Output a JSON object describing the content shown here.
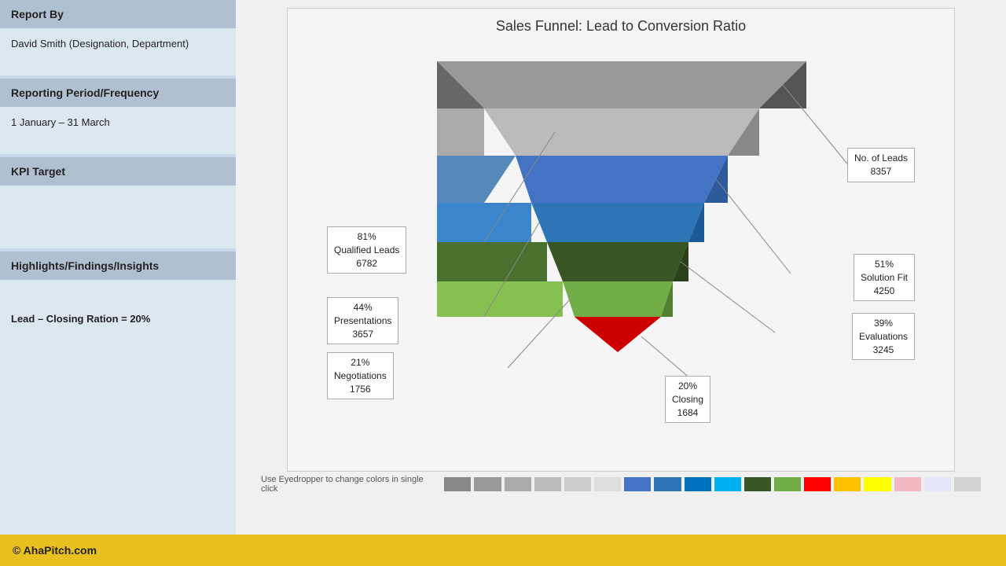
{
  "sidebar": {
    "report_by_label": "Report By",
    "report_by_value": "David Smith (Designation, Department)",
    "period_label": "Reporting Period/Frequency",
    "period_value": "1 January – 31 March",
    "kpi_label": "KPI Target",
    "insights_label": "Highlights/Findings/Insights",
    "insights_value": "Lead – Closing Ration = 20%"
  },
  "chart": {
    "title": "Sales Funnel: Lead to Conversion Ratio",
    "funnel_stages": [
      {
        "label": "No. of Leads",
        "value": "8357",
        "pct": "",
        "color": "#888888",
        "callout_side": "right"
      },
      {
        "label": "Qualified Leads",
        "value": "6782",
        "pct": "81%",
        "color": "#aaaaaa",
        "callout_side": "left"
      },
      {
        "label": "Solution Fit",
        "value": "4250",
        "pct": "51%",
        "color": "#4472c4",
        "callout_side": "right"
      },
      {
        "label": "Presentations",
        "value": "3657",
        "pct": "44%",
        "color": "#2e75b6",
        "callout_side": "left"
      },
      {
        "label": "Evaluations",
        "value": "3245",
        "pct": "39%",
        "color": "#375623",
        "callout_side": "right"
      },
      {
        "label": "Negotiations",
        "value": "1756",
        "pct": "21%",
        "color": "#70ad47",
        "callout_side": "left"
      },
      {
        "label": "Closing",
        "value": "1684",
        "pct": "20%",
        "color": "#ff0000",
        "callout_side": "right"
      }
    ]
  },
  "footer": {
    "brand": "© AhaPitch.com",
    "eyedropper_text": "Use Eyedropper to change colors in single click"
  },
  "swatches": [
    "#888",
    "#999",
    "#aaa",
    "#bbb",
    "#ccc",
    "#ddd",
    "#4472c4",
    "#2e75b6",
    "#0070c0",
    "#00b0f0",
    "#375623",
    "#70ad47",
    "#ff0000",
    "#ffc000",
    "#ffff00",
    "#f4b8c1",
    "#e6e6fa",
    "#d3d3d3"
  ]
}
